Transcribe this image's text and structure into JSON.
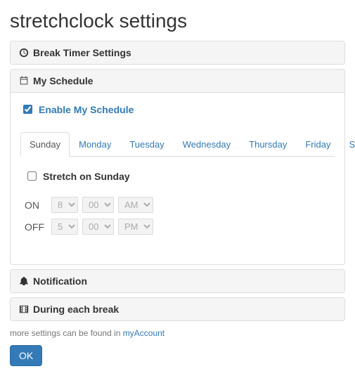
{
  "page_title": "stretchclock settings",
  "sections": {
    "break_timer": {
      "label": "Break Timer Settings"
    },
    "my_schedule": {
      "label": "My Schedule"
    },
    "notification": {
      "label": "Notification"
    },
    "during_break": {
      "label": "During each break"
    }
  },
  "schedule": {
    "enable_label": "Enable My Schedule",
    "enable_checked": true,
    "tabs": [
      "Sunday",
      "Monday",
      "Tuesday",
      "Wednesday",
      "Thursday",
      "Friday",
      "Saturday"
    ],
    "active_tab": "Sunday",
    "stretch_label": "Stretch on Sunday",
    "stretch_checked": false,
    "on_label": "ON",
    "off_label": "OFF",
    "on_time": {
      "hour": "8",
      "minute": "00",
      "period": "AM"
    },
    "off_time": {
      "hour": "5",
      "minute": "00",
      "period": "PM"
    }
  },
  "footer": {
    "note_prefix": "more settings can be found in ",
    "note_link": "myAccount",
    "ok_label": "OK"
  }
}
